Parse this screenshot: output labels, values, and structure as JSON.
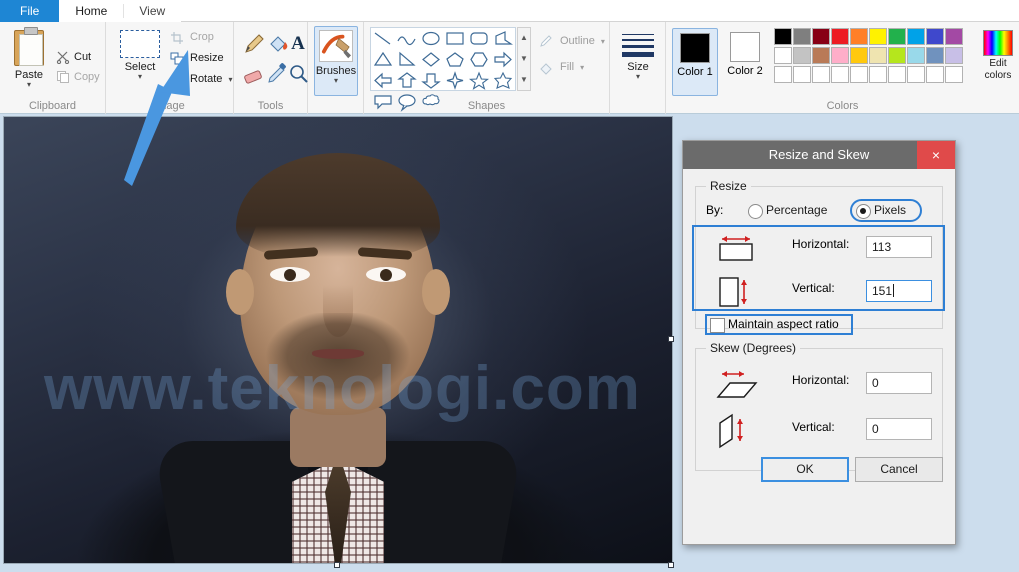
{
  "window": {
    "app_title": "Paint"
  },
  "tabs": [
    {
      "label": "File",
      "state": "file"
    },
    {
      "label": "Home",
      "state": "active"
    },
    {
      "label": "View",
      "state": "inactive"
    }
  ],
  "ribbon": {
    "groups": [
      {
        "name": "clipboard",
        "label": "Clipboard"
      },
      {
        "name": "image",
        "label": "Image"
      },
      {
        "name": "tools",
        "label": "Tools"
      },
      {
        "name": "brushes",
        "label": ""
      },
      {
        "name": "shapes",
        "label": "Shapes"
      },
      {
        "name": "size",
        "label": ""
      },
      {
        "name": "colors",
        "label": "Colors"
      }
    ],
    "clipboard": {
      "paste_label": "Paste",
      "cut_label": "Cut",
      "copy_label": "Copy",
      "group_label": "Clipboard"
    },
    "image": {
      "select_label": "Select",
      "crop_label": "Crop",
      "resize_label": "Resize",
      "rotate_label": "Rotate",
      "group_label": "Image"
    },
    "tools": {
      "group_label": "Tools",
      "items": [
        "pencil-icon",
        "fill-bucket-icon",
        "text-icon",
        "eraser-icon",
        "color-picker-icon",
        "magnifier-icon"
      ]
    },
    "brushes": {
      "label": "Brushes"
    },
    "shapes": {
      "group_label": "Shapes",
      "outline_label": "Outline",
      "fill_label": "Fill",
      "items": [
        "line",
        "curve",
        "oval",
        "rectangle",
        "rounded-rectangle",
        "polygon",
        "triangle",
        "right-triangle",
        "diamond",
        "pentagon",
        "hexagon",
        "right-arrow",
        "left-arrow",
        "up-arrow",
        "down-arrow",
        "four-point-star",
        "five-point-star",
        "six-point-star",
        "rounded-callout",
        "oval-callout",
        "cloud-callout"
      ]
    },
    "size": {
      "label": "Size"
    },
    "colors": {
      "group_label": "Colors",
      "color1_label": "Color 1",
      "color2_label": "Color 2",
      "color1_value": "#000000",
      "color2_value": "#ffffff",
      "edit_colors_label": "Edit colors",
      "palette_row1": [
        "#000000",
        "#7f7f7f",
        "#880015",
        "#ed1c24",
        "#ff7f27",
        "#fff200",
        "#22b14c",
        "#00a2e8",
        "#3f48cc",
        "#a349a4"
      ],
      "palette_row2": [
        "#ffffff",
        "#c3c3c3",
        "#b97a57",
        "#ffaec9",
        "#ffc90e",
        "#efe4b0",
        "#b5e61d",
        "#99d9ea",
        "#7092be",
        "#c8bfe7"
      ],
      "palette_row3": [
        "#ffffff",
        "#ffffff",
        "#ffffff",
        "#ffffff",
        "#ffffff",
        "#ffffff",
        "#ffffff",
        "#ffffff",
        "#ffffff",
        "#ffffff"
      ]
    }
  },
  "canvas": {
    "watermark_text": "www.teknologi.com"
  },
  "dialog": {
    "title": "Resize and Skew",
    "close_label": "×",
    "resize": {
      "legend": "Resize",
      "by_label": "By:",
      "percentage_label": "Percentage",
      "pixels_label": "Pixels",
      "selected_unit": "Pixels",
      "horizontal_label": "Horizontal:",
      "horizontal_value": "113",
      "vertical_label": "Vertical:",
      "vertical_value": "151",
      "maintain_aspect_label": "Maintain aspect ratio",
      "maintain_aspect_checked": "false"
    },
    "skew": {
      "legend": "Skew (Degrees)",
      "horizontal_label": "Horizontal:",
      "horizontal_value": "0",
      "vertical_label": "Vertical:",
      "vertical_value": "0"
    },
    "ok_label": "OK",
    "cancel_label": "Cancel"
  },
  "annotations": {
    "arrow_color": "#4a97e0",
    "highlight_color": "#2e7fd4"
  }
}
